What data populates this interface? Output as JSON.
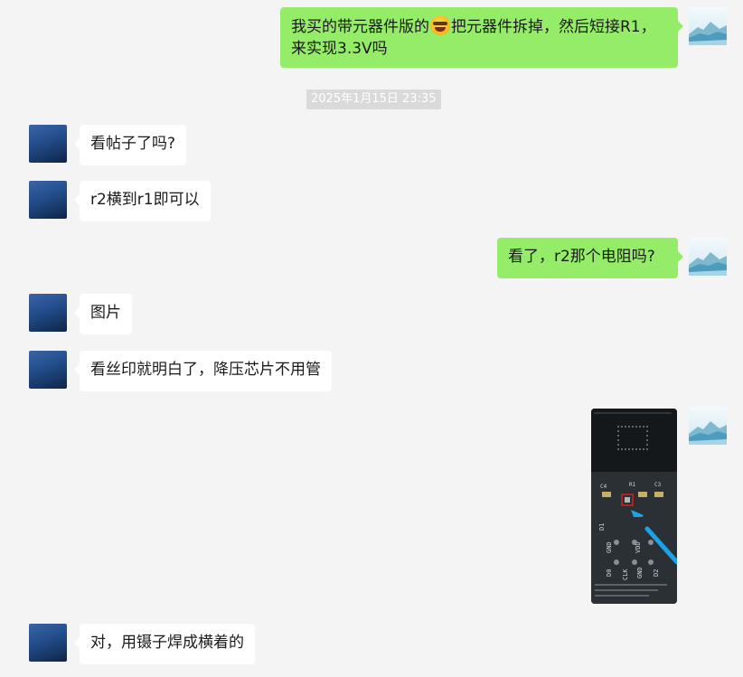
{
  "messages": [
    {
      "sender": "self",
      "text_before": "我买的带元器件版的",
      "emoji": "laughing-emoji",
      "text_after_line1": "把元器件拆掉，然后短接R1，",
      "text_line2": "来实现3.3V吗"
    },
    {
      "timestamp": "2025年1月15日 23:35"
    },
    {
      "sender": "other",
      "text": "看帖子了吗?"
    },
    {
      "sender": "other",
      "text": "r2横到r1即可以"
    },
    {
      "sender": "self",
      "text": "看了，r2那个电阻吗?"
    },
    {
      "sender": "other",
      "text": "图片"
    },
    {
      "sender": "other",
      "text": "看丝印就明白了，降压芯片不用管"
    },
    {
      "sender": "self",
      "image": "circuit-board-photo",
      "silkscreen": [
        "C4",
        "R1",
        "C3",
        "D1",
        "D0",
        "GND",
        "CLK",
        "VDD",
        "GND",
        "D2"
      ]
    },
    {
      "sender": "other",
      "text": "对，用镊子焊成横着的"
    }
  ],
  "colors": {
    "background": "#f4f4f4",
    "self_bubble": "#95ec69",
    "other_bubble": "#ffffff",
    "timestamp_bg": "#dadada",
    "annotation_red": "#e02020",
    "annotation_arrow": "#1aa3e8"
  }
}
